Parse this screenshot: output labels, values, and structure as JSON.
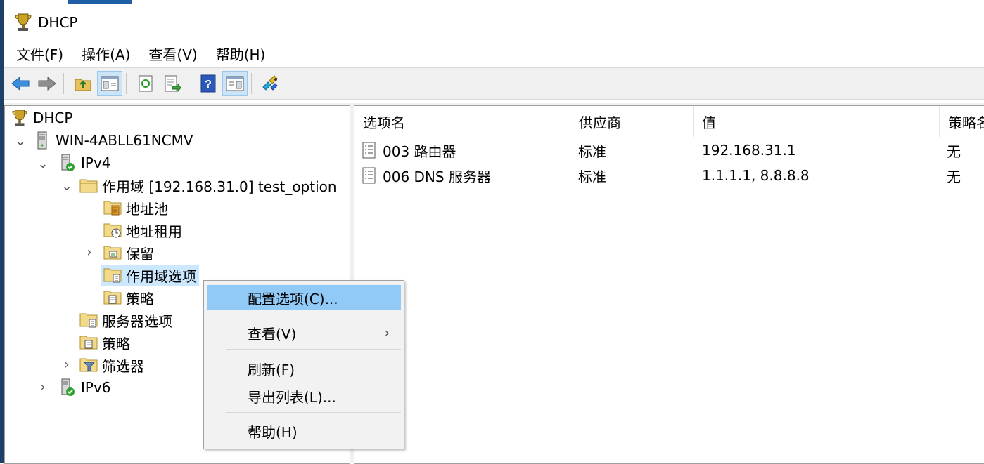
{
  "window": {
    "title": "DHCP",
    "icon": "dhcp-trophy-icon"
  },
  "menubar": [
    "文件(F)",
    "操作(A)",
    "查看(V)",
    "帮助(H)"
  ],
  "toolbar": [
    {
      "name": "back-icon"
    },
    {
      "name": "forward-icon"
    },
    {
      "sep": true
    },
    {
      "name": "up-folder-icon"
    },
    {
      "name": "show-hide-console-tree-icon",
      "active": true
    },
    {
      "sep": true
    },
    {
      "name": "refresh-icon"
    },
    {
      "name": "export-list-icon"
    },
    {
      "sep": true
    },
    {
      "name": "help-icon"
    },
    {
      "name": "show-hide-action-pane-icon",
      "active": true
    },
    {
      "sep": true
    },
    {
      "name": "dhcp-connect-icon"
    }
  ],
  "tree": {
    "root": "DHCP",
    "server": "WIN-4ABLL61NCMV",
    "ipv4": "IPv4",
    "scope": "作用域 [192.168.31.0] test_option",
    "address_pool": "地址池",
    "address_leases": "地址租用",
    "reservations": "保留",
    "scope_options": "作用域选项",
    "policies_scope": "策略",
    "server_options": "服务器选项",
    "policies": "策略",
    "filters": "筛选器",
    "ipv6": "IPv6"
  },
  "list": {
    "columns": [
      "选项名",
      "供应商",
      "值",
      "策略名"
    ],
    "rows": [
      {
        "name": "003 路由器",
        "vendor": "标准",
        "value": "192.168.31.1",
        "policy": "无"
      },
      {
        "name": "006 DNS 服务器",
        "vendor": "标准",
        "value": "1.1.1.1, 8.8.8.8",
        "policy": "无"
      }
    ]
  },
  "context_menu": {
    "configure": "配置选项(C)...",
    "view": "查看(V)",
    "refresh": "刷新(F)",
    "export": "导出列表(L)...",
    "help": "帮助(H)"
  },
  "colors": {
    "selection": "#cce8ff",
    "menu_highlight": "#91c9f7",
    "window_edge": "#1e3f66"
  }
}
